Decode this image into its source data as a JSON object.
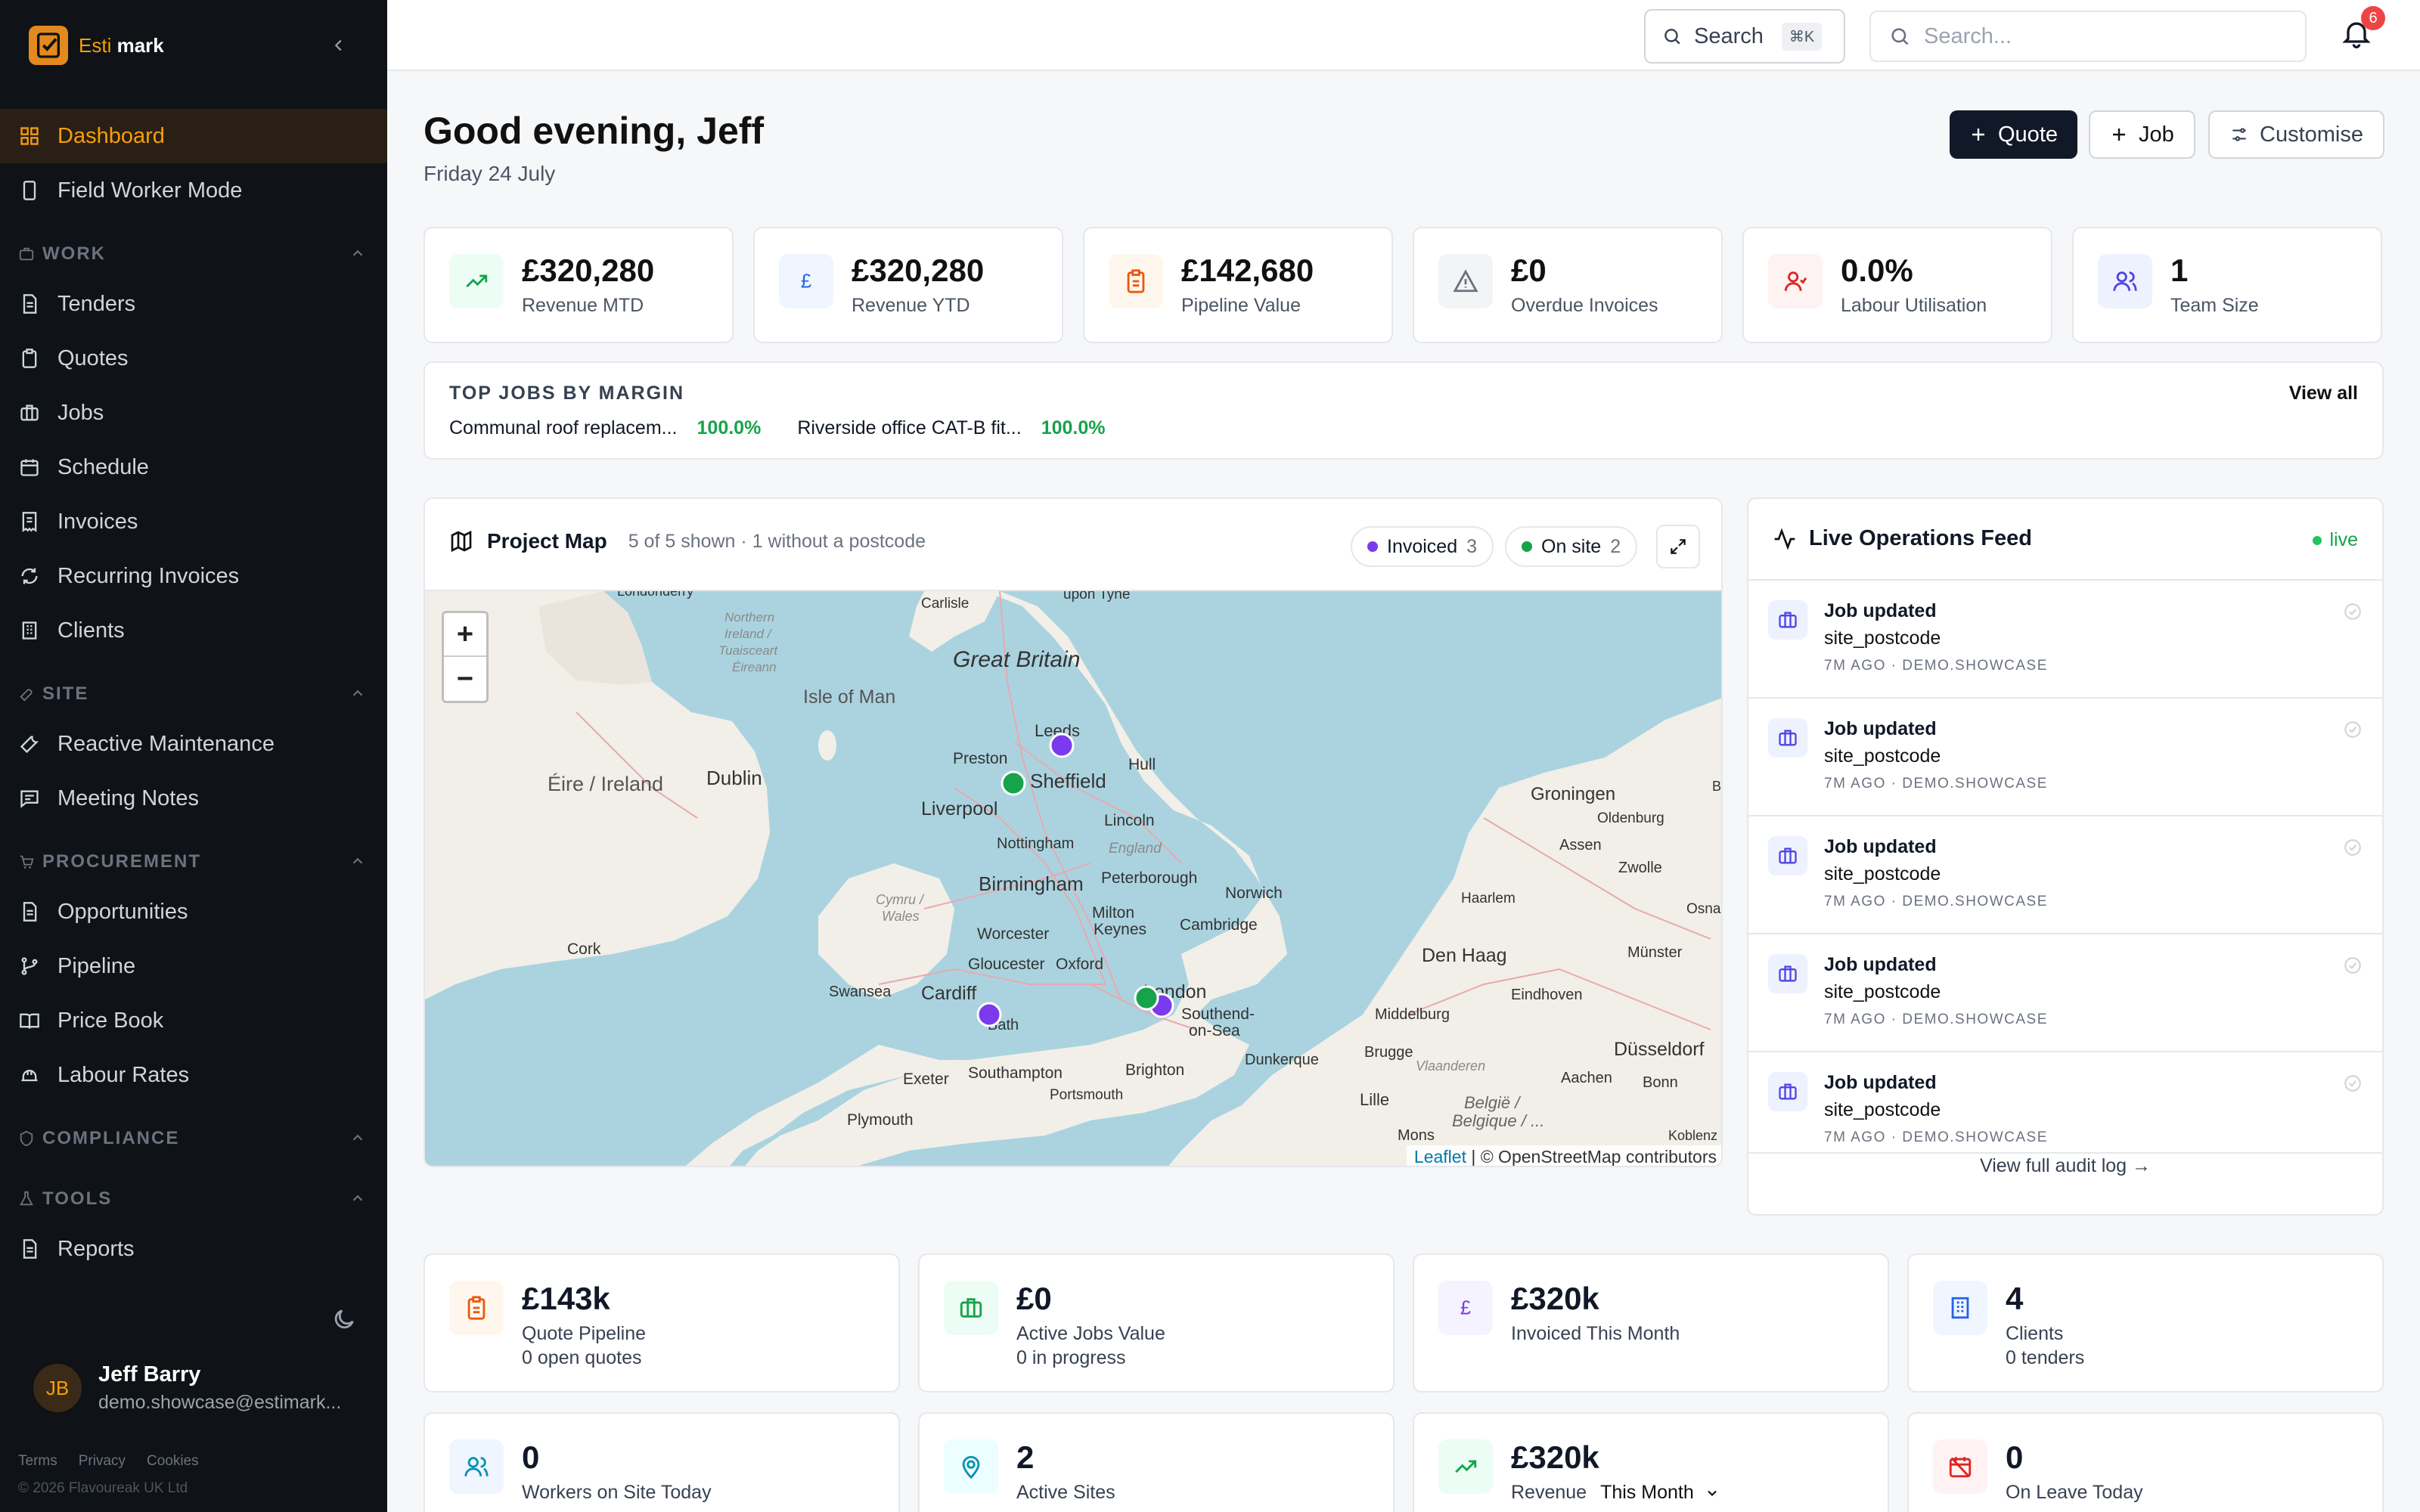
{
  "brand": {
    "name_prefix": "Esti",
    "name_bold": "mark"
  },
  "sidebar": {
    "top_items": [
      {
        "label": "Dashboard",
        "icon": "dashboard-icon",
        "active": true
      },
      {
        "label": "Field Worker Mode",
        "icon": "phone-icon"
      }
    ],
    "sections": [
      {
        "title": "WORK",
        "items": [
          "Tenders",
          "Quotes",
          "Jobs",
          "Schedule",
          "Invoices",
          "Recurring Invoices",
          "Clients"
        ]
      },
      {
        "title": "SITE",
        "items": [
          "Reactive Maintenance",
          "Meeting Notes"
        ]
      },
      {
        "title": "PROCUREMENT",
        "items": [
          "Opportunities",
          "Pipeline",
          "Price Book",
          "Labour Rates"
        ]
      },
      {
        "title": "COMPLIANCE",
        "items": []
      },
      {
        "title": "TOOLS",
        "items": [
          "Reports"
        ]
      }
    ],
    "user": {
      "initials": "JB",
      "name": "Jeff Barry",
      "email": "demo.showcase@estimark..."
    },
    "footer_links": [
      "Terms",
      "Privacy",
      "Cookies"
    ],
    "copyright": "© 2026 Flavoureak UK Ltd"
  },
  "topbar": {
    "search_label": "Search",
    "search_shortcut": "⌘K",
    "search_placeholder": "Search...",
    "notification_count": "6"
  },
  "header": {
    "greeting": "Good evening, Jeff",
    "date": "Friday 24 July",
    "buttons": {
      "quote": "Quote",
      "job": "Job",
      "customise": "Customise"
    }
  },
  "stats": [
    {
      "value": "£320,280",
      "label": "Revenue MTD",
      "icon": "trending-up-icon"
    },
    {
      "value": "£320,280",
      "label": "Revenue YTD",
      "icon": "pound-icon"
    },
    {
      "value": "£142,680",
      "label": "Pipeline Value",
      "icon": "clipboard-icon"
    },
    {
      "value": "£0",
      "label": "Overdue Invoices",
      "icon": "warning-icon"
    },
    {
      "value": "0.0%",
      "label": "Labour Utilisation",
      "icon": "user-icon"
    },
    {
      "value": "1",
      "label": "Team Size",
      "icon": "users-icon"
    }
  ],
  "top_jobs": {
    "title": "TOP JOBS BY MARGIN",
    "view_all": "View all",
    "items": [
      {
        "name": "Communal roof replacem...",
        "margin": "100.0%"
      },
      {
        "name": "Riverside office CAT-B fit...",
        "margin": "100.0%"
      }
    ]
  },
  "map": {
    "title": "Project Map",
    "subtitle": "5 of 5 shown · 1 without a postcode",
    "legend": [
      {
        "label": "Invoiced",
        "count": "3",
        "color": "#7c3aed"
      },
      {
        "label": "On site",
        "count": "2",
        "color": "#16a34a"
      }
    ],
    "attribution_leaflet": "Leaflet",
    "attribution_rest": "| © OpenStreetMap contributors",
    "labels": {
      "londonderry": "Londonderry",
      "northern_ireland": "Northern",
      "ireland2": "Ireland /",
      "tuaisceart": "Tuaisceart",
      "eireann": "Éireann",
      "carlisle": "Carlisle",
      "upon_tyne": "upon Tyne",
      "great_britain": "Great Britain",
      "isle_of_man": "Isle of Man",
      "dublin": "Dublin",
      "eire": "Éire / Ireland",
      "preston": "Preston",
      "leeds": "Leeds",
      "hull": "Hull",
      "sheffield": "Sheffield",
      "liverpool": "Liverpool",
      "lincoln": "Lincoln",
      "nottingham": "Nottingham",
      "england": "England",
      "birmingham": "Birmingham",
      "peterborough": "Peterborough",
      "norwich": "Norwich",
      "cymru": "Cymru /",
      "wales": "Wales",
      "milton": "Milton",
      "keynes": "Keynes",
      "worcester": "Worcester",
      "cork": "Cork",
      "cambridge": "Cambridge",
      "gloucester": "Gloucester",
      "oxford": "Oxford",
      "swansea": "Swansea",
      "cardiff": "Cardiff",
      "bath": "Bath",
      "london": "London",
      "southend": "Southend-",
      "on_sea": "on-Sea",
      "exeter": "Exeter",
      "southampton": "Southampton",
      "brighton": "Brighton",
      "portsmouth": "Portsmouth",
      "plymouth": "Plymouth",
      "dunkerque": "Dunkerque",
      "groningen": "Groningen",
      "assen": "Assen",
      "oldenburg": "Oldenburg",
      "zwolle": "Zwolle",
      "haarlem": "Haarlem",
      "osna": "Osnal",
      "den_haag": "Den Haag",
      "munster": "Münster",
      "middelburg": "Middelburg",
      "eindhoven": "Eindhoven",
      "brugge": "Brugge",
      "dusseldorf": "Düsseldorf",
      "vlaanderen": "Vlaanderen",
      "aachen": "Aachen",
      "bonn": "Bonn",
      "lille": "Lille",
      "belgique": "België /",
      "belgique2": "Belgique / ...",
      "mons": "Mons",
      "koblenz": "Koblenz",
      "br": "Br"
    }
  },
  "feed": {
    "title": "Live Operations Feed",
    "live": "live",
    "items": [
      {
        "title": "Job updated",
        "sub": "site_postcode",
        "meta": "7M AGO · DEMO.SHOWCASE"
      },
      {
        "title": "Job updated",
        "sub": "site_postcode",
        "meta": "7M AGO · DEMO.SHOWCASE"
      },
      {
        "title": "Job updated",
        "sub": "site_postcode",
        "meta": "7M AGO · DEMO.SHOWCASE"
      },
      {
        "title": "Job updated",
        "sub": "site_postcode",
        "meta": "7M AGO · DEMO.SHOWCASE"
      },
      {
        "title": "Job updated",
        "sub": "site_postcode",
        "meta": "7M AGO · DEMO.SHOWCASE"
      }
    ],
    "footer": "View full audit log →"
  },
  "kpis_row1": [
    {
      "value": "£143k",
      "label": "Quote Pipeline",
      "sub": "0 open quotes",
      "icon": "clipboard-icon"
    },
    {
      "value": "£0",
      "label": "Active Jobs Value",
      "sub": "0 in progress",
      "icon": "briefcase-icon"
    },
    {
      "value": "£320k",
      "label": "Invoiced This Month",
      "sub": "",
      "icon": "pound-icon"
    },
    {
      "value": "4",
      "label": "Clients",
      "sub": "0 tenders",
      "icon": "building-icon"
    }
  ],
  "kpis_row2": [
    {
      "value": "0",
      "label": "Workers on Site Today",
      "icon": "users-icon"
    },
    {
      "value": "2",
      "label": "Active Sites",
      "icon": "map-pin-icon"
    },
    {
      "value": "£320k",
      "label": "Revenue",
      "select": "This Month",
      "icon": "trending-up-icon"
    },
    {
      "value": "0",
      "label": "On Leave Today",
      "icon": "calendar-off-icon"
    }
  ]
}
